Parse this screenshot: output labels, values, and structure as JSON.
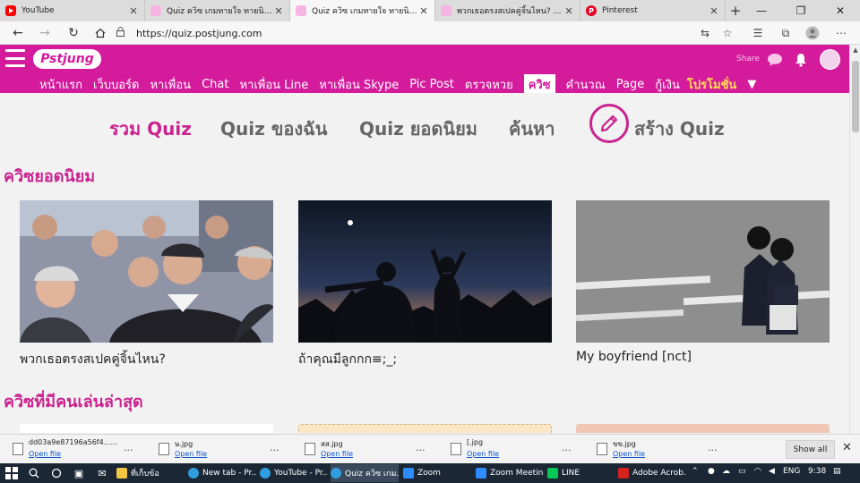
{
  "browser": {
    "tabs": [
      {
        "title": "YouTube",
        "icon_color": "#ff0000",
        "active": false
      },
      {
        "title": "Quiz ควิซ เกมทายใจ ทายนิสัย เกม",
        "icon_color": "#d41b9c",
        "active": false
      },
      {
        "title": "Quiz ควิซ เกมทายใจ ทายนิสัย เกม",
        "icon_color": "#d41b9c",
        "active": true
      },
      {
        "title": "พวกเธอตรงสเปคคู่จิ้นไหน? - Quiz",
        "icon_color": "#d41b9c",
        "active": false
      },
      {
        "title": "Pinterest",
        "icon_color": "#e60023",
        "active": false
      }
    ],
    "new_tab_glyph": "+",
    "url": "https://quiz.postjung.com",
    "window_controls": {
      "minimize": "—",
      "maximize": "❐",
      "close": "✕"
    }
  },
  "site": {
    "logo_text": "Pstjung",
    "share_label": "Share",
    "nav": [
      {
        "label": "หน้าแรก"
      },
      {
        "label": "เว็บบอร์ด"
      },
      {
        "label": "หาเพื่อน"
      },
      {
        "label": "Chat"
      },
      {
        "label": "หาเพื่อน Line"
      },
      {
        "label": "หาเพื่อน Skype"
      },
      {
        "label": "Pic Post"
      },
      {
        "label": "ตรวจหวย"
      },
      {
        "label": "ควิซ"
      },
      {
        "label": "คำนวณ"
      },
      {
        "label": "Page"
      },
      {
        "label": "กู้เงิน"
      },
      {
        "label": "โปรโมชั่น"
      },
      {
        "label": "▼"
      }
    ]
  },
  "quiz_tabs": {
    "all": "รวม Quiz",
    "mine": "Quiz ของฉัน",
    "popular": "Quiz ยอดนิยม",
    "search": "ค้นหา",
    "create": "สร้าง Quiz"
  },
  "sections": {
    "popular_title": "ควิซยอดนิยม",
    "recent_title": "ควิซที่มีคนเล่นล่าสุด"
  },
  "popular_cards": [
    {
      "title": "พวกเธอตรงสเปคคู่จิ้นไหน?"
    },
    {
      "title": "ถ้าคุณมีลูกกก≡;_;"
    },
    {
      "title": "My boyfriend [nct]"
    }
  ],
  "downloads": {
    "items": [
      {
        "name": "dd03a9e87196a56f4....jpg",
        "action": "Open file"
      },
      {
        "name": "ษ.jpg",
        "action": "Open file"
      },
      {
        "name": "สส.jpg",
        "action": "Open file"
      },
      {
        "name": "[.jpg",
        "action": "Open file"
      },
      {
        "name": "ขข.jpg",
        "action": "Open file"
      }
    ],
    "more_glyph": "...",
    "show_all": "Show all",
    "close_glyph": "✕"
  },
  "taskbar": {
    "apps": [
      {
        "label": "ที่เก็บข้อ",
        "color": "#f2c744"
      },
      {
        "label": "New tab - Pr...",
        "color": "#2f9de0"
      },
      {
        "label": "YouTube - Pr...",
        "color": "#2f9de0"
      },
      {
        "label": "Quiz ควิซ เกม...",
        "color": "#2f9de0"
      },
      {
        "label": "Zoom",
        "color": "#2d8cff"
      },
      {
        "label": "Zoom Meeting",
        "color": "#2d8cff"
      },
      {
        "label": "LINE",
        "color": "#06c755"
      },
      {
        "label": "Adobe Acrob...",
        "color": "#d7221f"
      }
    ],
    "lang": "ENG",
    "time": "9:38"
  }
}
